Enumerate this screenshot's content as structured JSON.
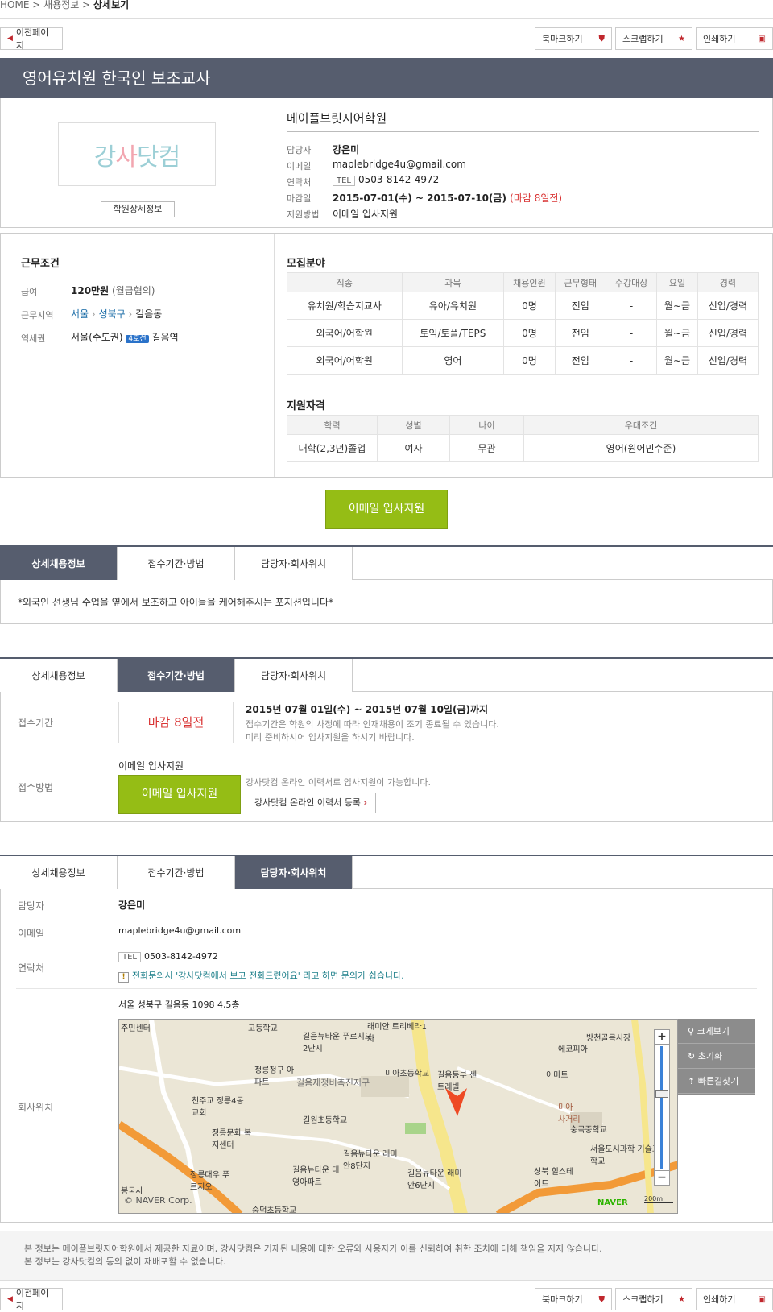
{
  "breadcrumb": {
    "home": "HOME",
    "sep": ">",
    "level2": "채용정보",
    "current": "상세보기"
  },
  "toolbar": {
    "prev": "이전페이지",
    "bookmark": "북마크하기",
    "scrap": "스크랩하기",
    "print": "인쇄하기"
  },
  "job_title": "영어유치원 한국인 보조교사",
  "academy": {
    "logo_text_a": "강",
    "logo_text_b": "사",
    "logo_text_c": "닷컴",
    "detail_button": "학원상세정보",
    "name": "메이플브릿지어학원",
    "contact_label": "담당자",
    "contact": "강은미",
    "email_label": "이메일",
    "email": "maplebridge4u@gmail.com",
    "phone_label": "연락처",
    "phone_tag": "TEL",
    "phone": "0503-8142-4972",
    "deadline_label": "마감일",
    "deadline": "2015-07-01(수) ~ 2015-07-10(금)",
    "deadline_badge": "(마감 8일전)",
    "apply_label": "지원방법",
    "apply_method": "이메일 입사지원"
  },
  "conditions": {
    "title": "근무조건",
    "salary_label": "급여",
    "salary": "120만원",
    "salary_note": "(월급협의)",
    "area_label": "근무지역",
    "area_city": "서울",
    "area_gu": "성북구",
    "area_dong": "길음동",
    "station_label": "역세권",
    "station_region": "서울(수도권)",
    "station_line": "4호선",
    "station_name": "길음역"
  },
  "recruit": {
    "title": "모집분야",
    "headers": [
      "직종",
      "과목",
      "채용인원",
      "근무형태",
      "수강대상",
      "요일",
      "경력"
    ],
    "rows": [
      [
        "유치원/학습지교사",
        "유아/유치원",
        "0명",
        "전임",
        "-",
        "월~금",
        "신입/경력"
      ],
      [
        "외국어/어학원",
        "토익/토플/TEPS",
        "0명",
        "전임",
        "-",
        "월~금",
        "신입/경력"
      ],
      [
        "외국어/어학원",
        "영어",
        "0명",
        "전임",
        "-",
        "월~금",
        "신입/경력"
      ]
    ]
  },
  "qualification": {
    "title": "지원자격",
    "headers": [
      "학력",
      "성별",
      "나이",
      "우대조건"
    ],
    "row": [
      "대학(2,3년)졸업",
      "여자",
      "무관",
      "영어(원어민수준)"
    ]
  },
  "apply_button": "이메일 입사지원",
  "tabs": [
    "상세채용정보",
    "접수기간·방법",
    "담당자·회사위치"
  ],
  "detail_text": "*외국인 선생님 수업을 옆에서 보조하고 아이들을 케어해주시는 포지션입니다*",
  "reception": {
    "period_label": "접수기간",
    "dday": "마감 8일전",
    "period": "2015년 07월 01일(수) ~ 2015년 07월 10일(금)까지",
    "note1": "접수기간은 학원의 사정에 따라 인재채용이 조기 종료될 수 있습니다.",
    "note2": "미리 준비하시어 입사지원을 하시기 바랍니다.",
    "method_label": "접수방법",
    "method": "이메일 입사지원",
    "method_button": "이메일 입사지원",
    "online_note": "강사닷컴 온라인 이력서로 입사지원이 가능합니다.",
    "online_button": "강사닷컴 온라인 이력서 등록"
  },
  "contact_section": {
    "person_label": "담당자",
    "person": "강은미",
    "email_label": "이메일",
    "email": "maplebridge4u@gmail.com",
    "phone_label": "연락처",
    "phone_tag": "TEL",
    "phone": "0503-8142-4972",
    "phone_tip": "전화문의시 '강사닷컴에서 보고 전화드렸어요' 라고 하면 문의가 쉽습니다.",
    "location_label": "회사위치",
    "address": "서울 성북구 길음동 1098 4,5층"
  },
  "map": {
    "enlarge": "크게보기",
    "reset": "초기화",
    "route": "빠른길찾기",
    "copyright": "© NAVER Corp.",
    "brand": "NAVER",
    "scale": "200m",
    "labels": [
      "고등학교",
      "래미안 트리베라1차",
      "방천골목시장",
      "에코피아",
      "길음뉴타운 푸르지오2단지",
      "정릉청구 아파트",
      "길음재정비촉진지구",
      "미아초등학교",
      "이마트",
      "천주교 정릉4동교회",
      "길원초등학교",
      "미아 사거리",
      "숭곡중학교",
      "정릉문화 복지센터",
      "길음뉴타운 래미안8단지",
      "서울도시과학 기술고등학교",
      "길음뉴타운 태영아파트",
      "길음뉴타운 래미안6단지",
      "성북 힐스테이트",
      "정릉대우 푸르지오",
      "봉국사",
      "주민센터",
      "길음동부 센트레빌",
      "숭덕초등학교"
    ]
  },
  "footer": {
    "line1": "본 정보는 메이플브릿지어학원에서 제공한 자료이며, 강사닷컴은 기재된 내용에 대한 오류와 사용자가 이를 신뢰하여 취한 조치에 대해 책임을 지지 않습니다.",
    "line2": "본 정보는 강사닷컴의 동의 없이 재배포할 수 없습니다."
  },
  "colors": {
    "header_bg": "#565d6e",
    "accent_green": "#95bd15",
    "deadline_red": "#d93434",
    "link_blue": "#1d6ea8"
  }
}
